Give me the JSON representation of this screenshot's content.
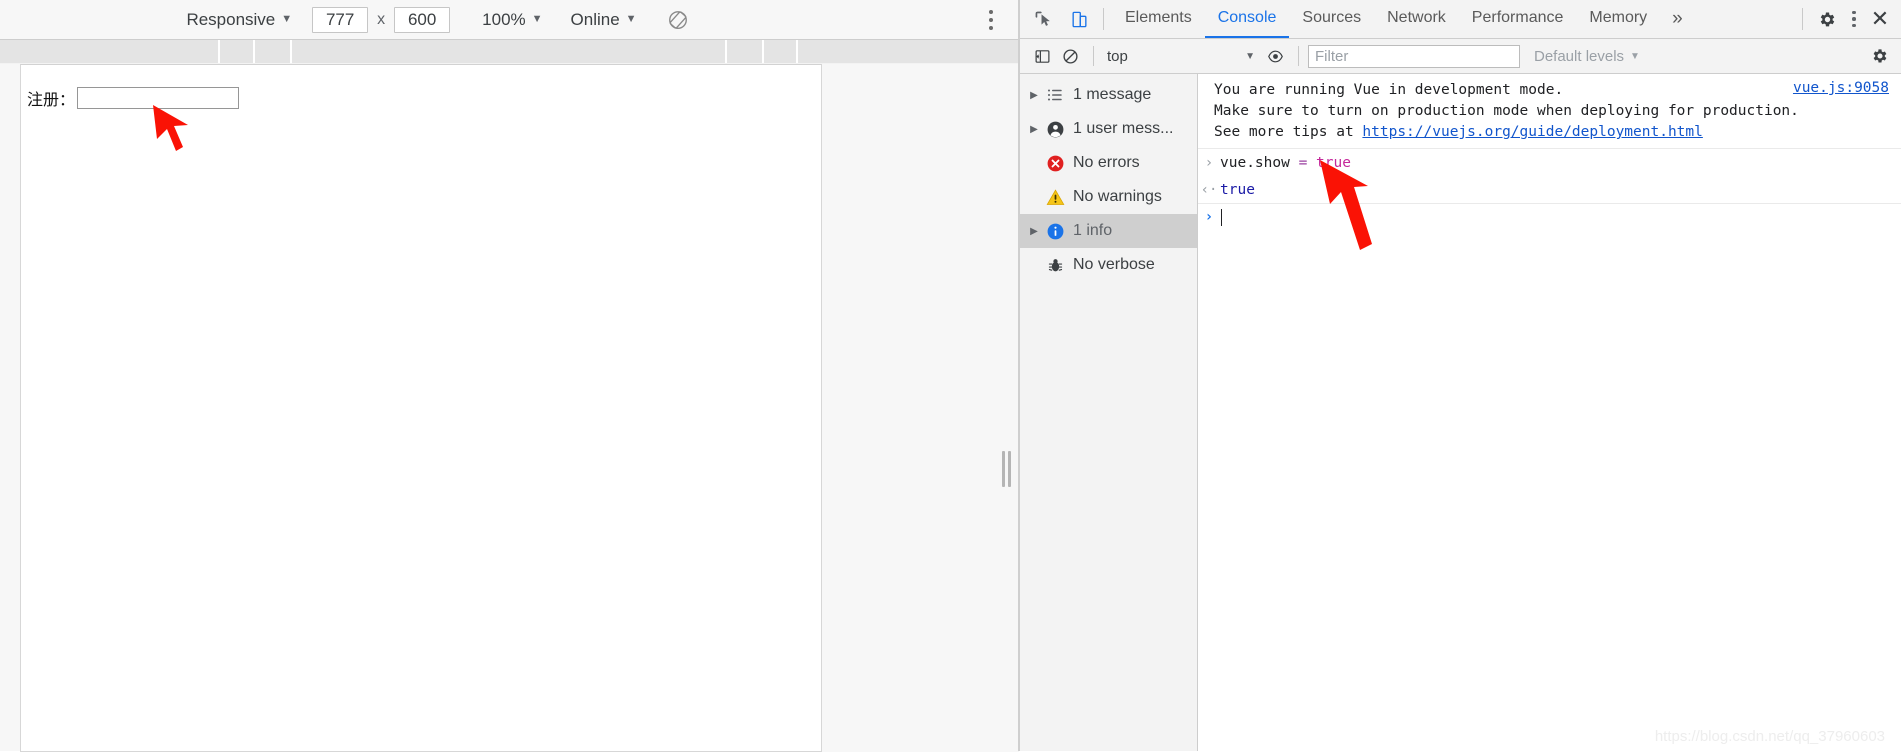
{
  "device_toolbar": {
    "device_preset": "Responsive",
    "width": "777",
    "height": "600",
    "dimension_separator": "x",
    "zoom": "100%",
    "throttling": "Online",
    "rotate_icon": "rotate-device-icon",
    "menu_icon": "more-options-icon"
  },
  "page": {
    "form_label": "注册：",
    "input_value": "",
    "input_placeholder": ""
  },
  "devtools": {
    "inspect_icon": "inspect-element-icon",
    "device_toggle_icon": "toggle-device-toolbar-icon",
    "tabs": [
      {
        "label": "Elements",
        "active": false
      },
      {
        "label": "Console",
        "active": true
      },
      {
        "label": "Sources",
        "active": false
      },
      {
        "label": "Network",
        "active": false
      },
      {
        "label": "Performance",
        "active": false
      },
      {
        "label": "Memory",
        "active": false
      }
    ],
    "more_tabs": "»",
    "settings_icon": "gear-icon",
    "main_menu_icon": "more-options-icon",
    "close_icon": "close-icon",
    "console_toolbar": {
      "sidebar_toggle_icon": "console-sidebar-toggle-icon",
      "clear_icon": "clear-console-icon",
      "context": "top",
      "eye_icon": "live-expression-icon",
      "filter_value": "",
      "filter_placeholder": "Filter",
      "levels": "Default levels",
      "settings_icon": "gear-icon"
    },
    "sidebar": [
      {
        "label": "1 message",
        "icon": "list-icon",
        "expandable": true,
        "selected": false
      },
      {
        "label": "1 user mess...",
        "icon": "user-icon",
        "expandable": true,
        "selected": false
      },
      {
        "label": "No errors",
        "icon": "error-icon",
        "expandable": false,
        "selected": false
      },
      {
        "label": "No warnings",
        "icon": "warning-icon",
        "expandable": false,
        "selected": false
      },
      {
        "label": "1 info",
        "icon": "info-icon",
        "expandable": true,
        "selected": true
      },
      {
        "label": "No verbose",
        "icon": "bug-icon",
        "expandable": false,
        "selected": false
      }
    ],
    "messages": {
      "info_line1": "You are running Vue in development mode.",
      "info_line2": "Make sure to turn on production mode when deploying for production.",
      "info_line3_prefix": "See more tips at ",
      "info_line3_link": "https://vuejs.org/guide/deployment.html",
      "info_source": "vue.js:9058",
      "command_expr": "vue.show",
      "command_operator": " = ",
      "command_value": "true",
      "result_value": "true",
      "prompt_value": ""
    }
  },
  "watermark": "https://blog.csdn.net/qq_37960603",
  "colors": {
    "accent": "#1a73e8",
    "error": "#e03131",
    "warning": "#f5c518",
    "info": "#1a73e8",
    "link": "#1155cc",
    "keyword": "#c5299b",
    "result": "#1a1aa6",
    "annotation": "#fa1205"
  }
}
